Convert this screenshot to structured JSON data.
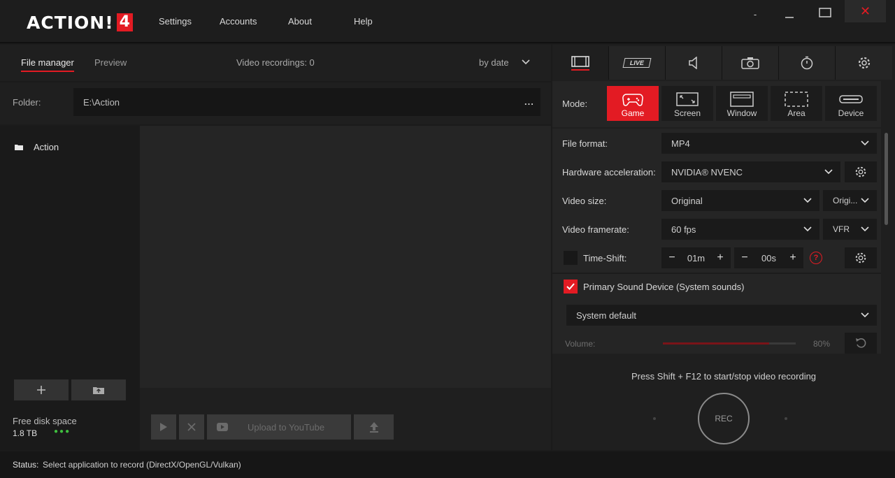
{
  "app": {
    "logo_text": "ACTION!",
    "logo_version": "4"
  },
  "menu": {
    "settings": "Settings",
    "accounts": "Accounts",
    "about": "About",
    "help": "Help"
  },
  "window": {
    "minimize": "-",
    "close": "✕"
  },
  "left": {
    "tabs": {
      "file_manager": "File manager",
      "preview": "Preview"
    },
    "recordings_label": "Video recordings: 0",
    "sort_value": "by date",
    "folder_label": "Folder:",
    "folder_path": "E:\\Action",
    "folder_more": "...",
    "tree_item": "Action",
    "disk_label": "Free disk space",
    "disk_value": "1.8 TB",
    "upload_label": "Upload to YouTube"
  },
  "right": {
    "tabs": [
      "video-icon",
      "live-icon",
      "audio-icon",
      "camera-icon",
      "timer-icon",
      "gear-icon"
    ],
    "live_label": "LIVE",
    "mode_label": "Mode:",
    "modes": [
      {
        "label": "Game",
        "active": true
      },
      {
        "label": "Screen",
        "active": false
      },
      {
        "label": "Window",
        "active": false
      },
      {
        "label": "Area",
        "active": false
      },
      {
        "label": "Device",
        "active": false
      }
    ],
    "file_format": {
      "label": "File format:",
      "value": "MP4"
    },
    "hw_accel": {
      "label": "Hardware acceleration:",
      "value": "NVIDIA® NVENC"
    },
    "video_size": {
      "label": "Video size:",
      "value": "Original",
      "value2": "Origi..."
    },
    "video_framerate": {
      "label": "Video framerate:",
      "value": "60 fps",
      "value2": "VFR"
    },
    "timeshift": {
      "label": "Time-Shift:",
      "minutes": "01m",
      "seconds": "00s",
      "checked": false
    },
    "primary_sound": {
      "label": "Primary Sound Device (System sounds)",
      "checked": true,
      "device": "System default"
    },
    "volume": {
      "label": "Volume:",
      "value": "80%",
      "level": 0.8
    },
    "hotkey_hint": "Press Shift + F12 to start/stop video recording",
    "rec_label": "REC"
  },
  "status": {
    "label": "Status:",
    "text": "Select application to record  (DirectX/OpenGL/Vulkan)"
  },
  "colors": {
    "accent": "#e31b23",
    "background": "#1b1b1b",
    "panel": "#252525"
  }
}
